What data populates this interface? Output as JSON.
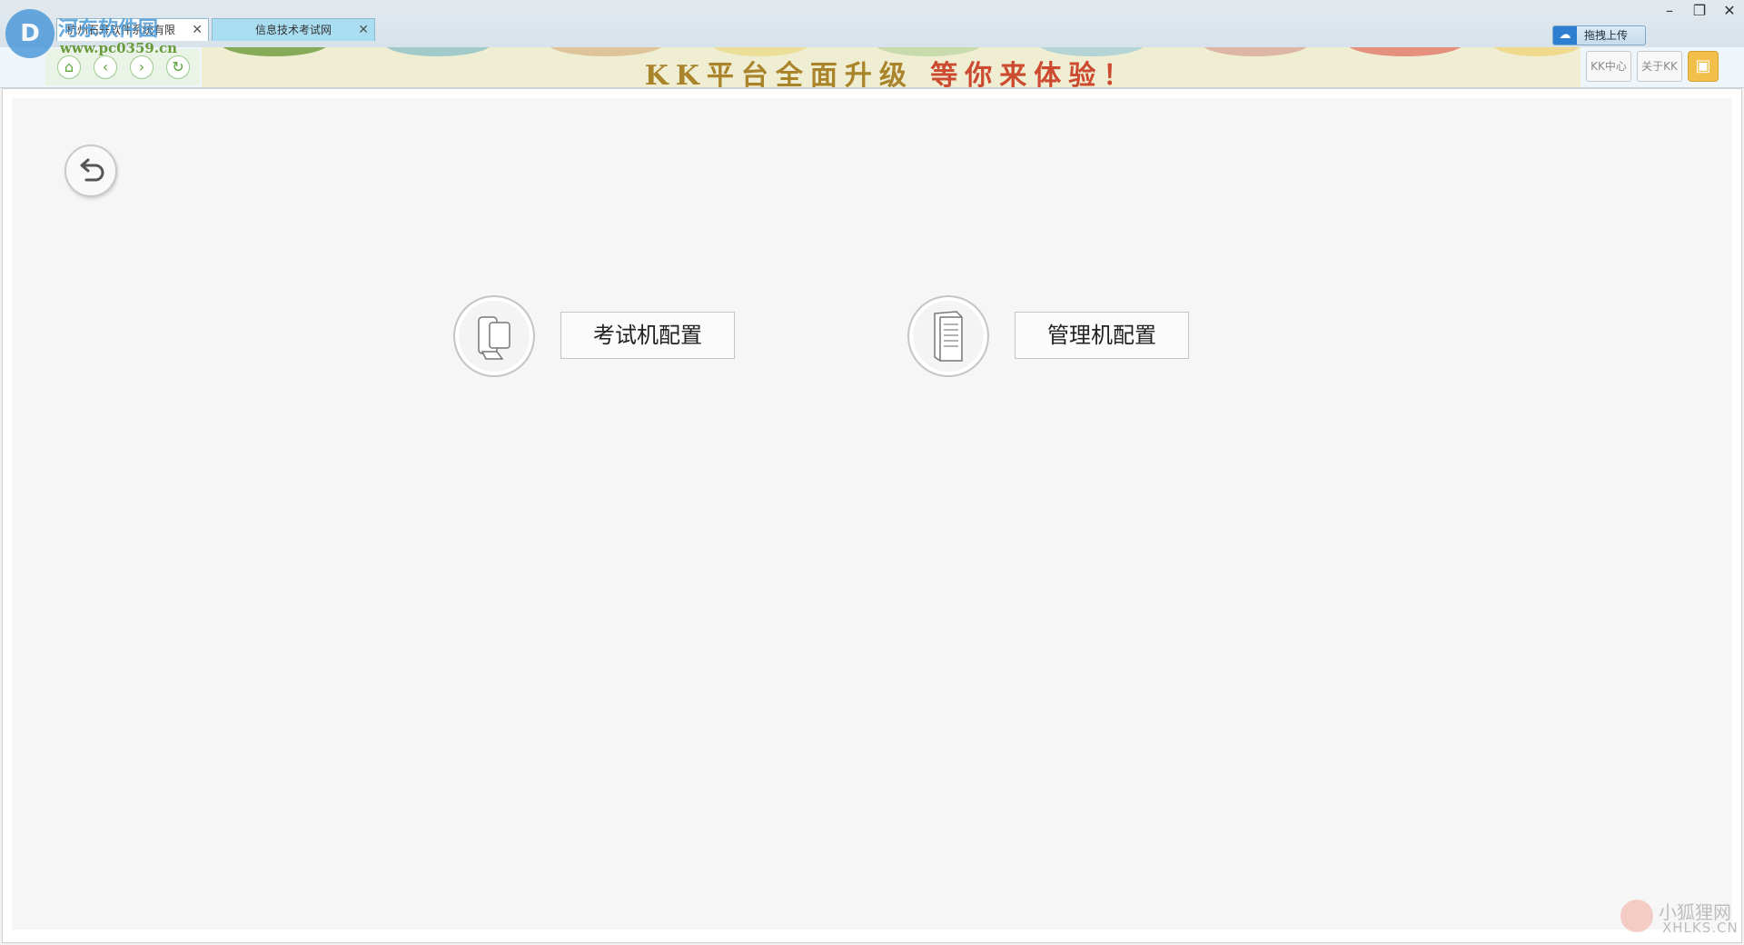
{
  "tabs": [
    {
      "label": "杭州石开软件系统有限"
    },
    {
      "label": "信息技术考试网"
    }
  ],
  "window_controls": {
    "minimize": "–",
    "restore": "❐",
    "close": "✕"
  },
  "upload": {
    "label": "拖拽上传",
    "icon": "cloud-icon"
  },
  "nav": {
    "home": "⌂",
    "back": "‹",
    "forward": "›",
    "refresh": "↻"
  },
  "banner": {
    "text_main": "KK平台全面升级",
    "text_accent": "等你来体验！"
  },
  "toolbar_right": {
    "kk_center": "KK中心",
    "about": "关于KK",
    "briefcase_icon": "briefcase-icon"
  },
  "main": {
    "back_icon": "undo-arrow-icon",
    "options": [
      {
        "label": "考试机配置",
        "icon": "exam-computer-icon"
      },
      {
        "label": "管理机配置",
        "icon": "server-tower-icon"
      }
    ]
  },
  "watermarks": {
    "site_name": "河东软件园",
    "site_url": "www.pc0359.cn",
    "fox_cn": "小狐狸网",
    "fox_en": "XHLKS.CN"
  },
  "colors": {
    "tab_active": "#ffffff",
    "tab_inactive": "#a9def2",
    "nav_green": "#59a43b",
    "banner_gold": "#a9842a",
    "banner_red": "#cc4a30"
  }
}
